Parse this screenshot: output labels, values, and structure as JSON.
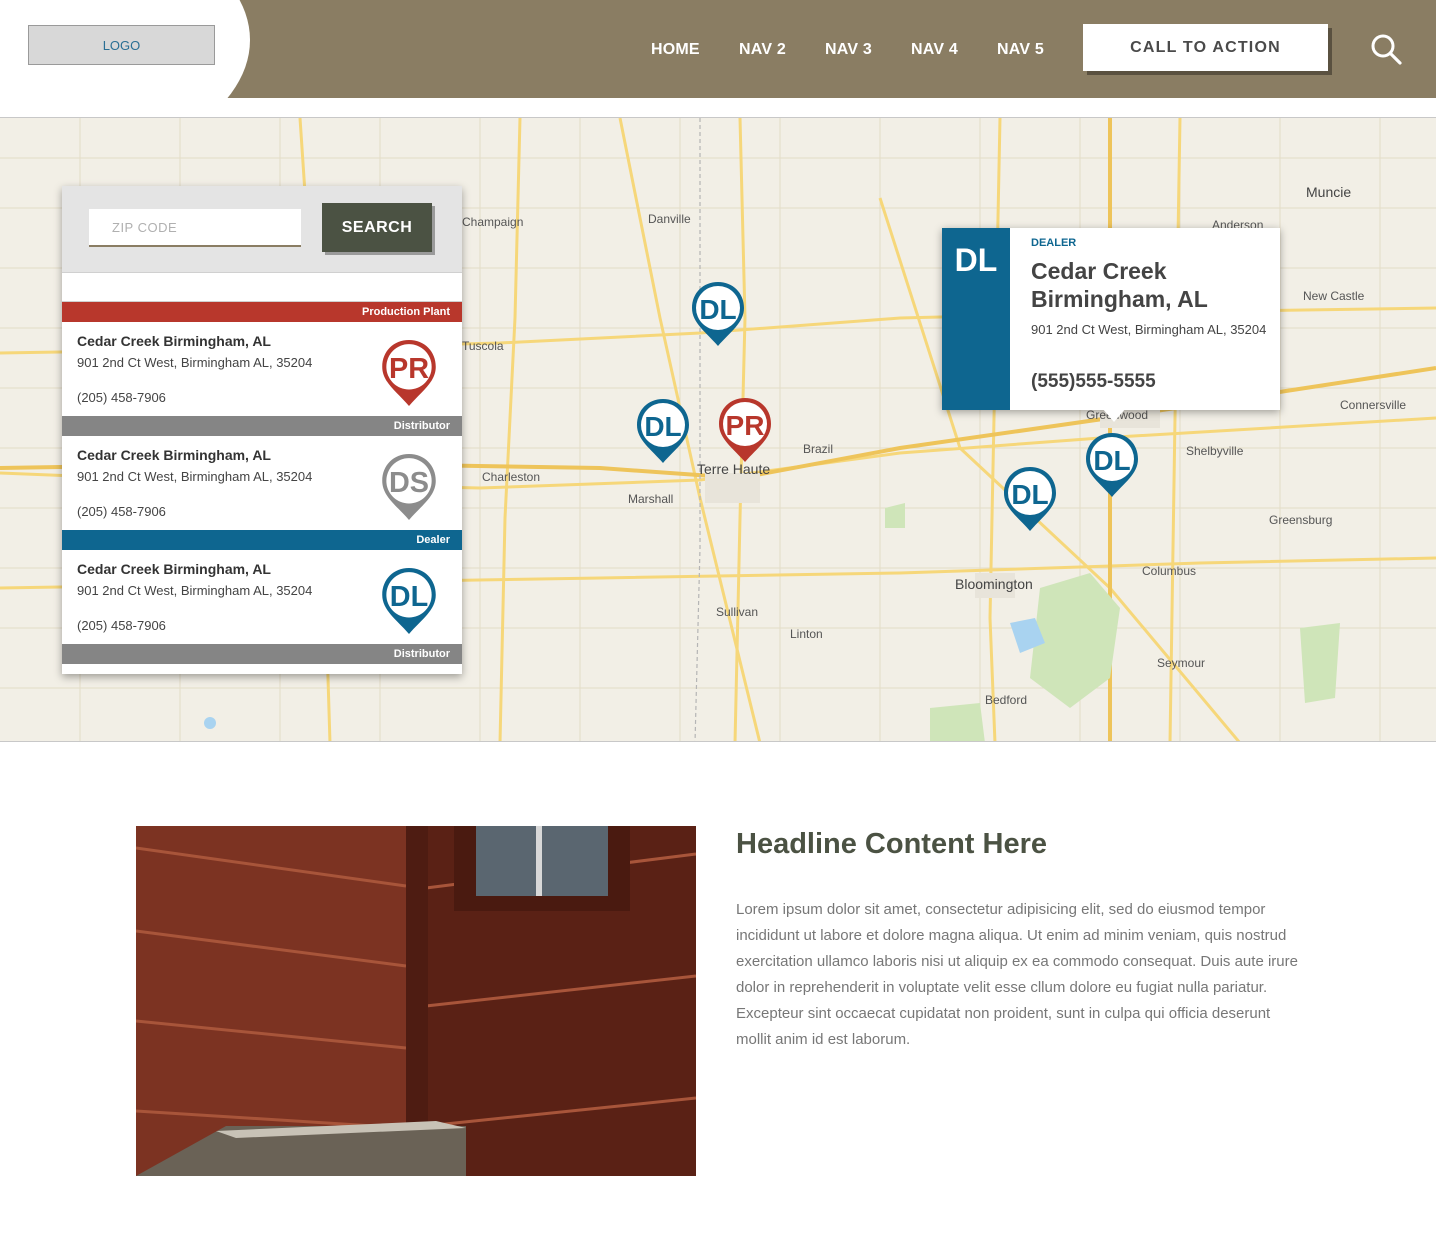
{
  "header": {
    "logo": "LOGO",
    "nav": [
      "HOME",
      "NAV 2",
      "NAV 3",
      "NAV 4",
      "NAV 5"
    ],
    "cta": "CALL TO ACTION",
    "colors": {
      "bar": "#8a7d63",
      "accent": "#4b5243"
    }
  },
  "locator": {
    "zip_placeholder": "ZIP CODE",
    "search_label": "SEARCH",
    "categories": {
      "production": "Production Plant",
      "distributor": "Distributor",
      "dealer": "Dealer"
    },
    "entries": [
      {
        "name": "Cedar Creek Birmingham, AL",
        "address": "901 2nd Ct West, Birmingham AL, 35204",
        "phone": "(205) 458-7906",
        "badge": "PR"
      },
      {
        "name": "Cedar Creek Birmingham, AL",
        "address": "901 2nd Ct West, Birmingham AL, 35204",
        "phone": "(205) 458-7906",
        "badge": "DS"
      },
      {
        "name": "Cedar Creek Birmingham, AL",
        "address": "901 2nd Ct West, Birmingham AL, 35204",
        "phone": "(205) 458-7906",
        "badge": "DL"
      }
    ],
    "pin_colors": {
      "PR": "#b8372c",
      "DS": "#8c8c8c",
      "DL": "#0e6690"
    }
  },
  "map": {
    "cities": [
      "Danville",
      "Champaign",
      "Tuscola",
      "Charleston",
      "Marshall",
      "Terre Haute",
      "Brazil",
      "Bloomington",
      "Columbus",
      "Greensburg",
      "Shelbyville",
      "Connersville",
      "New Castle",
      "Muncie",
      "Sullivan",
      "Linton",
      "Bedford",
      "Seymour",
      "Greenwood",
      "Anderson"
    ],
    "pins": [
      "DL",
      "DL",
      "PR",
      "DL",
      "DL"
    ]
  },
  "popup": {
    "badge": "DL",
    "type": "DEALER",
    "name": "Cedar Creek Birmingham, AL",
    "address": "901 2nd Ct West, Birmingham AL, 35204",
    "phone": "(555)555-5555"
  },
  "content": {
    "headline": "Headline Content Here",
    "body": "Lorem ipsum dolor sit amet, consectetur adipisicing elit, sed do eiusmod tempor incididunt ut labore et dolore magna aliqua. Ut enim ad minim veniam, quis nostrud exercitation ullamco laboris nisi ut aliquip ex ea commodo consequat. Duis aute irure dolor in reprehenderit in voluptate velit esse cllum dolore eu fugiat nulla pariatur. Excepteur sint occaecat cupidatat non proident, sunt in culpa qui officia deserunt mollit anim id est laborum."
  }
}
